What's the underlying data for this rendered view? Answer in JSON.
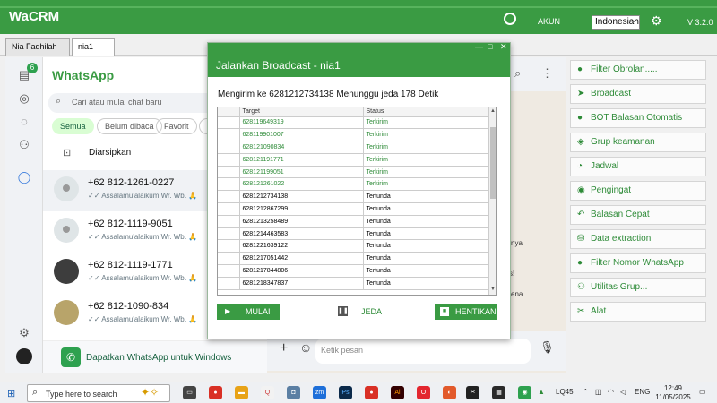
{
  "app": {
    "title": "WaCRM",
    "akun_label": "AKUN",
    "language": "Indonesian",
    "version": "V 3.2.0"
  },
  "tabs": [
    {
      "label": "Nia Fadhilah"
    },
    {
      "label": "nia1"
    }
  ],
  "rail": {
    "badge": "6"
  },
  "whatsapp": {
    "title": "WhatsApp",
    "search_placeholder": "Cari atau mulai chat baru",
    "filters": [
      "Semua",
      "Belum dibaca",
      "Favorit",
      "G"
    ],
    "archived_label": "Diarsipkan",
    "chats": [
      {
        "name": "+62 812-1261-0227",
        "message": "✓✓ Assalamu'alaikum Wr. Wb. 🙏"
      },
      {
        "name": "+62 812-1119-9051",
        "message": "✓✓ Assalamu'alaikum Wr. Wb. 🙏"
      },
      {
        "name": "+62 812-1119-1771",
        "message": "✓✓ Assalamu'alaikum Wr. Wb. 🙏"
      },
      {
        "name": "+62 812-1090-834",
        "message": "✓✓ Assalamu'alaikum Wr. Wb. 🙏"
      }
    ],
    "promo": "Dapatkan WhatsApp untuk Windows"
  },
  "chat_area": {
    "composer_placeholder": "Ketik pesan",
    "snippets": [
      "nya",
      "s!",
      "ena"
    ]
  },
  "side_buttons": [
    {
      "label": "Filter Obrolan.....",
      "icon": "filter-icon"
    },
    {
      "label": "Broadcast",
      "icon": "send-icon"
    },
    {
      "label": "BOT Balasan Otomatis",
      "icon": "bot-icon"
    },
    {
      "label": "Grup keamanan",
      "icon": "shield-icon"
    },
    {
      "label": "Jadwal",
      "icon": "clock-icon"
    },
    {
      "label": "Pengingat",
      "icon": "bell-icon"
    },
    {
      "label": "Balasan Cepat",
      "icon": "reply-icon"
    },
    {
      "label": "Data extraction",
      "icon": "data-icon"
    },
    {
      "label": "Filter Nomor WhatsApp",
      "icon": "filter-number-icon"
    },
    {
      "label": "Utilitas Grup...",
      "icon": "group-utility-icon"
    },
    {
      "label": "Alat",
      "icon": "tools-icon"
    }
  ],
  "dialog": {
    "title": "Jalankan Broadcast - nia1",
    "status": "Mengirim ke 6281212734138  Menunggu jeda 178 Detik",
    "columns": [
      "Target",
      "Status"
    ],
    "rows": [
      {
        "target": "628119649319",
        "status": "Terkirim"
      },
      {
        "target": "628119901007",
        "status": "Terkirim"
      },
      {
        "target": "628121090834",
        "status": "Terkirim"
      },
      {
        "target": "628121191771",
        "status": "Terkirim"
      },
      {
        "target": "628121199051",
        "status": "Terkirim"
      },
      {
        "target": "628121261022",
        "status": "Terkirim"
      },
      {
        "target": "6281212734138",
        "status": "Tertunda"
      },
      {
        "target": "6281212867299",
        "status": "Tertunda"
      },
      {
        "target": "6281213258489",
        "status": "Tertunda"
      },
      {
        "target": "6281214463583",
        "status": "Tertunda"
      },
      {
        "target": "6281221639122",
        "status": "Tertunda"
      },
      {
        "target": "6281217051442",
        "status": "Tertunda"
      },
      {
        "target": "6281217844806",
        "status": "Tertunda"
      },
      {
        "target": "6281218347837",
        "status": "Tertunda"
      }
    ],
    "btn_start": "MULAI",
    "btn_pause": "JEDA",
    "btn_stop": "HENTIKAN"
  },
  "taskbar": {
    "search_placeholder": "Type here to search",
    "network": "LQ45",
    "lang": "ENG",
    "time": "12:49",
    "date": "11/05/2025"
  }
}
